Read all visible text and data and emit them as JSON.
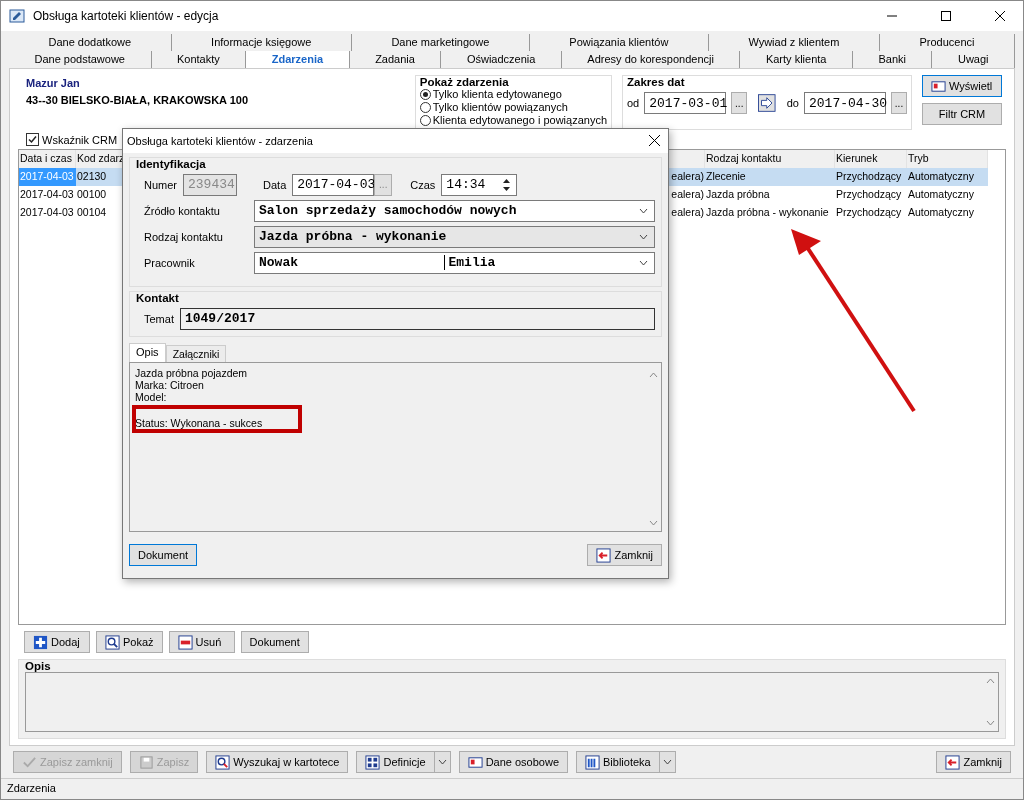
{
  "window": {
    "title": "Obsługa kartoteki klientów - edycja"
  },
  "tabs_row_1": [
    {
      "label": "Dane dodatkowe",
      "selected": false
    },
    {
      "label": "Informacje księgowe",
      "selected": false
    },
    {
      "label": "Dane marketingowe",
      "selected": false
    },
    {
      "label": "Powiązania klientów",
      "selected": false
    },
    {
      "label": "Wywiad z klientem",
      "selected": false
    },
    {
      "label": "Producenci",
      "selected": false
    }
  ],
  "tabs_row_2": [
    {
      "label": "Dane podstawowe",
      "selected": false
    },
    {
      "label": "Kontakty",
      "selected": false
    },
    {
      "label": "Zdarzenia",
      "selected": true
    },
    {
      "label": "Zadania",
      "selected": false
    },
    {
      "label": "Oświadczenia",
      "selected": false
    },
    {
      "label": "Adresy do korespondencji",
      "selected": false
    },
    {
      "label": "Karty klienta",
      "selected": false
    },
    {
      "label": "Banki",
      "selected": false
    },
    {
      "label": "Uwagi",
      "selected": false
    }
  ],
  "client": {
    "name": "Mazur Jan",
    "address": "43--30 BIELSKO-BIAŁA, KRAKOWSKA 100"
  },
  "show_events": {
    "title": "Pokaż zdarzenia",
    "options": [
      {
        "label": "Tylko klienta edytowanego",
        "selected": true
      },
      {
        "label": "Tylko klientów powiązanych",
        "selected": false
      },
      {
        "label": "Klienta edytowanego i powiązanych",
        "selected": false
      }
    ]
  },
  "date_range": {
    "title": "Zakres dat",
    "from_label": "od",
    "from": "2017-03-01",
    "picker": "...",
    "to_label": "do",
    "to": "2017-04-30"
  },
  "show_button": "Wyświetl",
  "crm_filter_button": "Filtr CRM",
  "crm_indicator": {
    "label": "Wskaźnik CRM",
    "checked": true
  },
  "table": {
    "columns": [
      "Data i czas",
      "Kod zdarz",
      "Rodzaj kontaktu",
      "Kierunek",
      "Tryb"
    ],
    "rows": [
      {
        "date": "2017-04-03",
        "code": "02130",
        "column_3": "ealera)",
        "type": "Zlecenie",
        "direction": "Przychodzący",
        "mode": "Automatyczny",
        "selected": true
      },
      {
        "date": "2017-04-03",
        "code": "00100",
        "column_3": "ealera)",
        "type": "Jazda próbna",
        "direction": "Przychodzący",
        "mode": "Automatyczny",
        "selected": false
      },
      {
        "date": "2017-04-03",
        "code": "00104",
        "column_3": "ealera)",
        "type": "Jazda próbna - wykonanie",
        "direction": "Przychodzący",
        "mode": "Automatyczny",
        "selected": false
      }
    ]
  },
  "actions": [
    {
      "label": "Dodaj"
    },
    {
      "label": "Pokaż"
    },
    {
      "label": "Usuń"
    },
    {
      "label": "Dokument"
    }
  ],
  "description": {
    "title": "Opis"
  },
  "toolbar": [
    {
      "label": "Zapisz zamknij",
      "disabled": true,
      "dropdown": false
    },
    {
      "label": "Zapisz",
      "disabled": true,
      "dropdown": false
    },
    {
      "label": "Wyszukaj w kartotece",
      "disabled": false,
      "dropdown": false
    },
    {
      "label": "Definicje",
      "disabled": false,
      "dropdown": true
    },
    {
      "label": "Dane osobowe",
      "disabled": false,
      "dropdown": false
    },
    {
      "label": "Biblioteka",
      "disabled": false,
      "dropdown": true
    }
  ],
  "close_button": "Zamknij",
  "status_bar": "Zdarzenia",
  "dialog": {
    "title": "Obsługa kartoteki klientów - zdarzenia",
    "identification": {
      "title": "Identyfikacja",
      "number_label": "Numer",
      "number": "239434",
      "date_label": "Data",
      "date": "2017-04-03",
      "picker": "...",
      "time_label": "Czas",
      "time": "14:34"
    },
    "fields": [
      {
        "label": "Źródło kontaktu",
        "value": "Salon sprzedaży samochodów nowych",
        "disabled": false
      },
      {
        "label": "Rodzaj kontaktu",
        "value": "Jazda próbna - wykonanie",
        "disabled": true
      },
      {
        "label": "Pracownik",
        "value": "Nowak",
        "second": "Emilia",
        "disabled": false
      }
    ],
    "contact": {
      "title": "Kontakt",
      "subject_label": "Temat",
      "subject": "1049/2017"
    },
    "tabs": [
      {
        "label": "Opis",
        "selected": true
      },
      {
        "label": "Załączniki",
        "selected": false
      }
    ],
    "memo": [
      "Jazda próbna pojazdem",
      "Marka: Citroen",
      "Model:",
      "Status: Wykonana - sukces"
    ],
    "document_button": "Dokument",
    "close_button": "Zamknij"
  }
}
